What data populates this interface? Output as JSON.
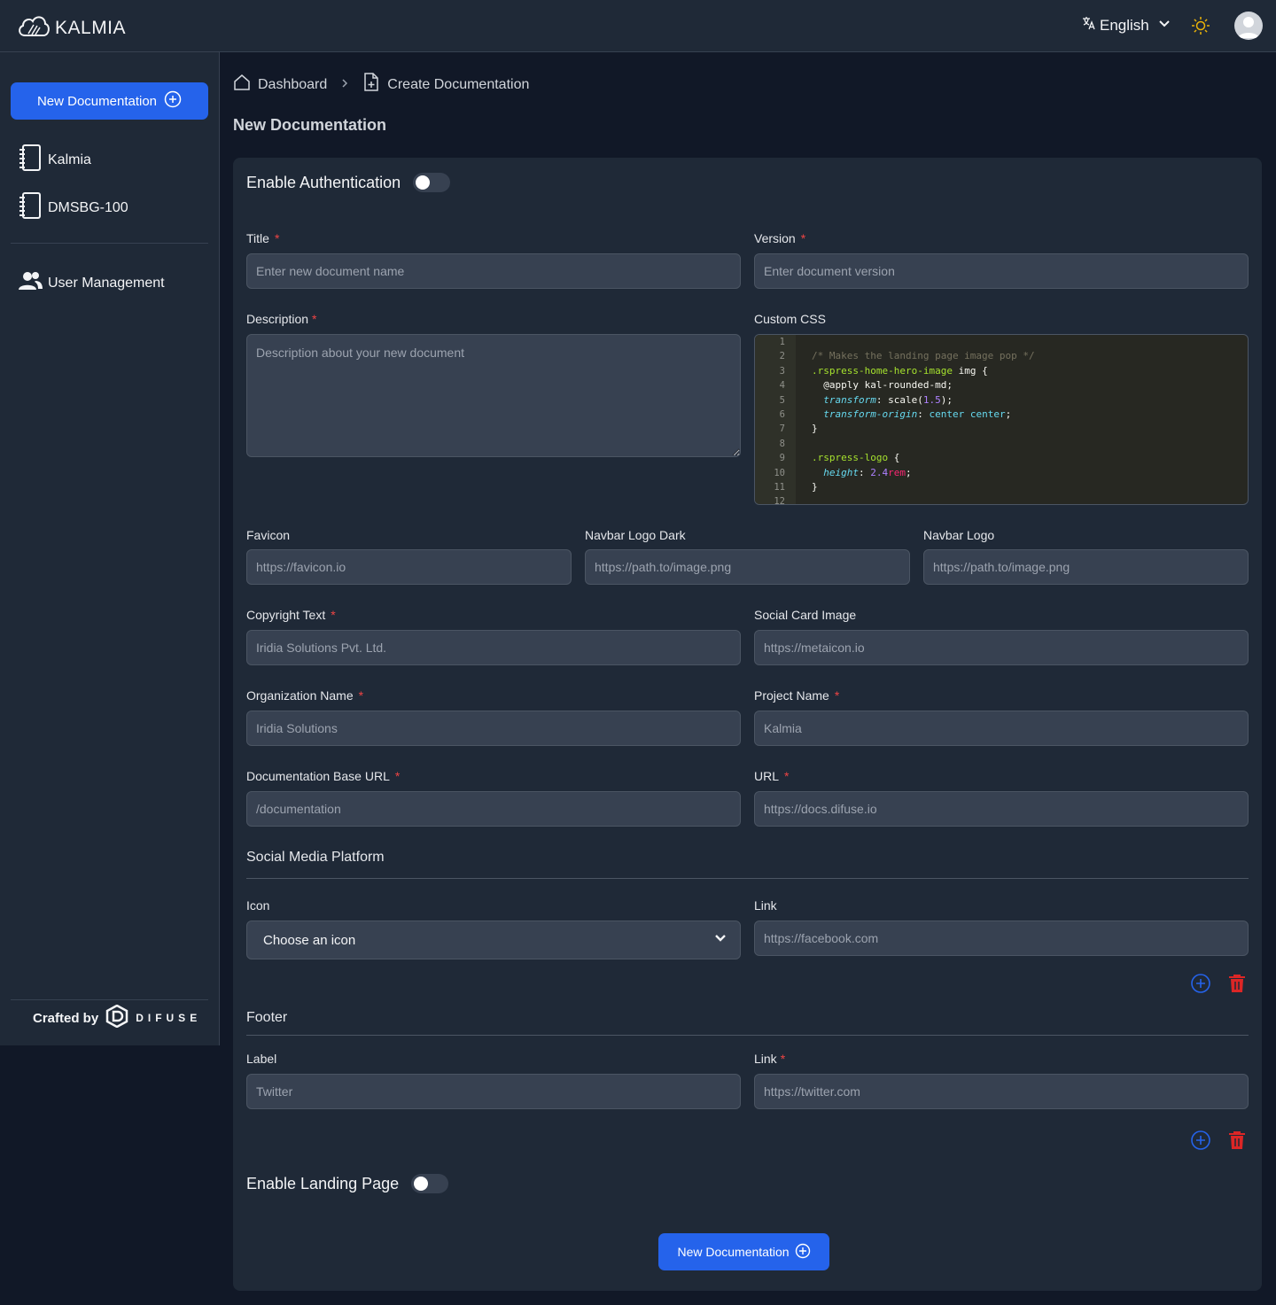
{
  "app": {
    "name": "KALMIA"
  },
  "header": {
    "language": "English"
  },
  "sidebar": {
    "new_button": "New Documentation",
    "docs": [
      {
        "label": "Kalmia"
      },
      {
        "label": "DMSBG-100"
      }
    ],
    "user_management": "User Management",
    "crafted_by": "Crafted by",
    "crafted_brand": "DIFUSE"
  },
  "breadcrumb": {
    "home": "Dashboard",
    "current": "Create Documentation"
  },
  "page": {
    "title": "New Documentation"
  },
  "form": {
    "enable_auth": "Enable Authentication",
    "title": {
      "label": "Title",
      "placeholder": "Enter new document name"
    },
    "version": {
      "label": "Version",
      "placeholder": "Enter document version"
    },
    "description": {
      "label": "Description",
      "placeholder": "Description about your new document"
    },
    "custom_css": {
      "label": "Custom CSS",
      "line_numbers": [
        "1",
        "2",
        "3",
        "4",
        "5",
        "6",
        "7",
        "8",
        "9",
        "10",
        "11",
        "12"
      ]
    },
    "favicon": {
      "label": "Favicon",
      "placeholder": "https://favicon.io"
    },
    "navbar_logo_dark": {
      "label": "Navbar Logo Dark",
      "placeholder": "https://path.to/image.png"
    },
    "navbar_logo": {
      "label": "Navbar Logo",
      "placeholder": "https://path.to/image.png"
    },
    "copyright": {
      "label": "Copyright Text",
      "placeholder": "Iridia Solutions Pvt. Ltd."
    },
    "social_card": {
      "label": "Social Card Image",
      "placeholder": "https://metaicon.io"
    },
    "org_name": {
      "label": "Organization Name",
      "placeholder": "Iridia Solutions"
    },
    "project_name": {
      "label": "Project Name",
      "placeholder": "Kalmia"
    },
    "base_url": {
      "label": "Documentation Base URL",
      "placeholder": "/documentation"
    },
    "url": {
      "label": "URL",
      "placeholder": "https://docs.difuse.io"
    },
    "social": {
      "title": "Social Media Platform",
      "icon_label": "Icon",
      "icon_select": "Choose an icon",
      "link_label": "Link",
      "link_placeholder": "https://facebook.com"
    },
    "footer": {
      "title": "Footer",
      "label_label": "Label",
      "label_placeholder": "Twitter",
      "link_label": "Link",
      "link_placeholder": "https://twitter.com"
    },
    "enable_landing": "Enable Landing Page",
    "submit": "New Documentation"
  },
  "colors": {
    "accent": "#2563eb",
    "danger": "#dc2626",
    "background": "#111827",
    "surface": "#1f2937",
    "input": "#374151"
  },
  "icons": [
    "kalmia-cloud-logo-icon",
    "translate-icon",
    "chevron-down-icon",
    "sun-icon",
    "user-avatar-icon",
    "plus-circle-icon",
    "notebook-icon",
    "users-icon",
    "difuse-logo-icon",
    "home-icon",
    "chevron-right-icon",
    "file-plus-icon",
    "trash-icon"
  ]
}
